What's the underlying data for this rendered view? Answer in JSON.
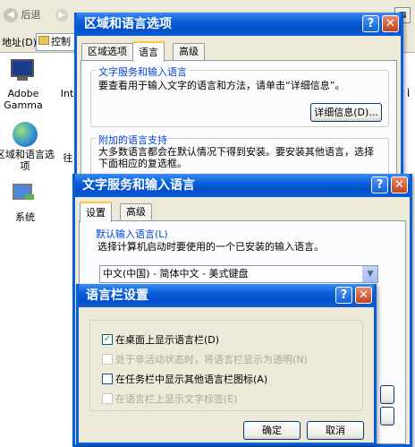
{
  "explorer": {
    "back_label": "后退",
    "address_label": "地址(D)",
    "address_value": "控制",
    "partial_label": "往",
    "icons": [
      {
        "label": "Adobe Gamma",
        "icon": "monitor-icon"
      },
      {
        "label": "Int",
        "icon": "internet-icon"
      },
      {
        "label": "区域和语言选项",
        "icon": "globe-icon"
      },
      {
        "label": "系统",
        "icon": "system-icon"
      }
    ]
  },
  "regional_dialog": {
    "title": "区域和语言选项",
    "tabs": [
      "区域选项",
      "语言",
      "高级"
    ],
    "text_services_group": "文字服务和输入语言",
    "text_services_desc": "要查看用于输入文字的语言和方法，请单击“详细信息”。",
    "details_button": "详细信息(D)...",
    "supplemental_group": "附加的语言支持",
    "supplemental_desc": "大多数语言都会在默认情况下得到安装。要安装其他语言，选择下面相应的复选框。"
  },
  "text_services_dialog": {
    "title": "文字服务和输入语言",
    "tabs": [
      "设置",
      "高级"
    ],
    "default_lang_group": "默认输入语言(L)",
    "default_lang_desc": "选择计算机启动时要使用的一个已安装的输入语言。",
    "default_lang_value": "中文(中国) - 简体中文 - 美式键盘"
  },
  "langbar_dialog": {
    "title": "语言栏设置",
    "options": [
      {
        "label": "在桌面上显示语言栏(D)",
        "checked": true,
        "enabled": true
      },
      {
        "label": "处于非活动状态时，将语言栏显示为透明(N)",
        "checked": false,
        "enabled": false
      },
      {
        "label": "在任务栏中显示其他语言栏图标(A)",
        "checked": false,
        "enabled": true
      },
      {
        "label": "在语言栏上显示文字标签(E)",
        "checked": false,
        "enabled": false
      }
    ],
    "ok_label": "确定",
    "cancel_label": "取消"
  },
  "title_buttons": {
    "help": "?",
    "close": "✕"
  }
}
